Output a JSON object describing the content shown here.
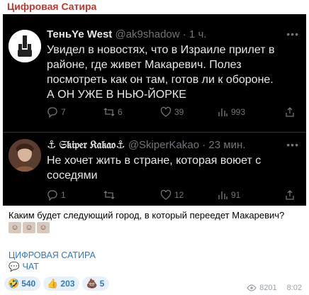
{
  "channel": {
    "name": "Цифровая Сатира"
  },
  "tweet1": {
    "author": "ТеньYe West",
    "handle": "@ak9shadow",
    "time": "· 1 ч.",
    "text_lines": [
      "Увидел в новостях, что в Израиле прилет в",
      "районе, где живет Макаревич. Полез",
      "посмотреть как он там, готов ли к обороне.",
      "А ОН УЖЕ В НЬЮ-ЙОРКЕ"
    ],
    "stats": {
      "replies": "7",
      "reposts": "6",
      "likes": "39",
      "views": "993"
    }
  },
  "tweet2": {
    "author": "⚓ 𝔖𝔨𝔦𝔭𝔢𝔯 𝔎𝔞𝔨𝔞𝔬⚓",
    "handle": "@SkiperKakao",
    "time": "· 23 мин.",
    "text_lines": [
      "Не хочет жить в стране, которая воюет с",
      "соседями"
    ],
    "stats": {
      "replies": "1",
      "reposts": "",
      "likes": "12",
      "views": "91"
    }
  },
  "caption": "Каким будет следующий город, в который переедет Макаревич?",
  "links": {
    "satire": "ЦИФРОВАЯ САТИРА",
    "chat": "ЧАТ"
  },
  "reactions": [
    {
      "icon": "rofl-emoji",
      "glyph": "🤣",
      "count": "540"
    },
    {
      "icon": "thumbs-up-emoji",
      "glyph": "👍",
      "count": "203"
    },
    {
      "icon": "poop-emoji",
      "glyph": "💩",
      "count": "5"
    }
  ],
  "meta": {
    "views": "8201",
    "time": "8:02"
  },
  "colors": {
    "accent": "#2b7bc4",
    "channel": "#c0392b",
    "tweet_bg": "#000000",
    "muted": "#71767b"
  }
}
